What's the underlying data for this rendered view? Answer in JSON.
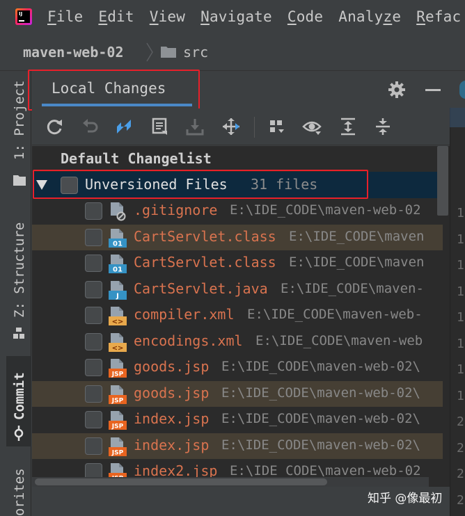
{
  "menu": {
    "logo_text": "IJ",
    "items": [
      {
        "mnemonic": "F",
        "rest": "ile"
      },
      {
        "mnemonic": "E",
        "rest": "dit"
      },
      {
        "mnemonic": "V",
        "rest": "iew"
      },
      {
        "mnemonic": "N",
        "rest": "avigate"
      },
      {
        "mnemonic": "C",
        "rest": "ode"
      },
      {
        "mnemonic": "",
        "rest": "Analy",
        "mn2": "z",
        "rest2": "e"
      },
      {
        "mnemonic": "R",
        "rest": "efac"
      }
    ]
  },
  "breadcrumb": {
    "project": "maven-web-02",
    "folder": "src"
  },
  "stripe": {
    "project": "1: Project",
    "structure": "Z: Structure",
    "commit": "Commit",
    "favorites": "orites"
  },
  "tool_window": {
    "tab_label": "Local Changes",
    "changelist_header": "Default Changelist",
    "unversioned_label": "Unversioned Files",
    "unversioned_count": "31 files"
  },
  "files": [
    {
      "name": ".gitignore",
      "path": "E:\\IDE_CODE\\maven-web-02",
      "icon": "ignore-file-icon",
      "badge": "",
      "highlighted": false
    },
    {
      "name": "CartServlet.class",
      "path": "E:\\IDE_CODE\\maven",
      "icon": "class-file-icon",
      "badge": "01",
      "highlighted": true
    },
    {
      "name": "CartServlet.class",
      "path": "E:\\IDE_CODE\\maven",
      "icon": "class-file-icon",
      "badge": "01",
      "highlighted": false
    },
    {
      "name": "CartServlet.java",
      "path": "E:\\IDE_CODE\\maven-",
      "icon": "java-file-icon",
      "badge": "J",
      "highlighted": false
    },
    {
      "name": "compiler.xml",
      "path": "E:\\IDE_CODE\\maven-web-",
      "icon": "xml-file-icon",
      "badge": "<>",
      "highlighted": false
    },
    {
      "name": "encodings.xml",
      "path": "E:\\IDE_CODE\\maven-web",
      "icon": "xml-file-icon",
      "badge": "<>",
      "highlighted": false
    },
    {
      "name": "goods.jsp",
      "path": "E:\\IDE_CODE\\maven-web-02\\",
      "icon": "jsp-file-icon",
      "badge": "JSP",
      "highlighted": false
    },
    {
      "name": "goods.jsp",
      "path": "E:\\IDE_CODE\\maven-web-02\\",
      "icon": "jsp-file-icon",
      "badge": "JSP",
      "highlighted": true
    },
    {
      "name": "index.jsp",
      "path": "E:\\IDE_CODE\\maven-web-02\\",
      "icon": "jsp-file-icon",
      "badge": "JSP",
      "highlighted": false
    },
    {
      "name": "index.jsp",
      "path": "E:\\IDE_CODE\\maven-web-02\\",
      "icon": "jsp-file-icon",
      "badge": "JSP",
      "highlighted": true
    },
    {
      "name": "index2.jsp",
      "path": "E:\\IDE_CODE\\maven-web-02",
      "icon": "jsp-file-icon",
      "badge": "JSP",
      "highlighted": false
    }
  ],
  "right_gutter_numbers": [
    "1",
    "1",
    "1",
    "1",
    "1",
    "1",
    "1",
    "1",
    "2",
    "2",
    "2",
    "2",
    "2"
  ],
  "watermark": "知乎 @像最初",
  "colors": {
    "accent": "#4a88c7",
    "unversioned_file": "#d9734f",
    "annotation_red": "#e8202a"
  }
}
